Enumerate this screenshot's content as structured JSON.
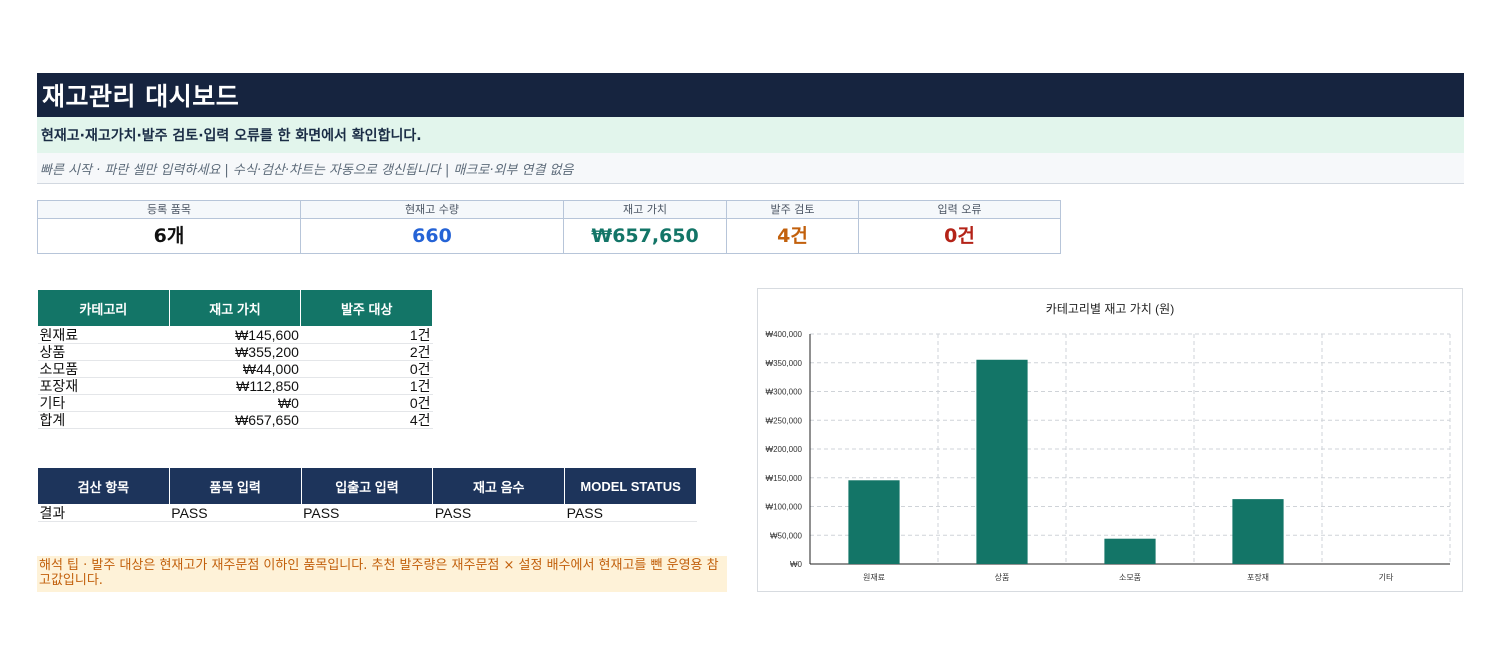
{
  "header": {
    "title": "재고관리 대시보드",
    "subtitle": "현재고·재고가치·발주 검토·입력 오류를 한 화면에서 확인합니다.",
    "quick_start": "빠른 시작 · 파란 셀만 입력하세요 | 수식·검산·차트는 자동으로 갱신됩니다 | 매크로·외부 연결 없음"
  },
  "kpis": [
    {
      "label": "등록 품목",
      "value": "6개",
      "color": "#111111"
    },
    {
      "label": "현재고 수량",
      "value": "660",
      "color": "#2563d6"
    },
    {
      "label": "재고 가치",
      "value": "₩657,650",
      "color": "#137567"
    },
    {
      "label": "발주 검토",
      "value": "4건",
      "color": "#c2600c"
    },
    {
      "label": "입력 오류",
      "value": "0건",
      "color": "#b42318"
    }
  ],
  "category_table": {
    "headers": [
      "카테고리",
      "재고 가치",
      "발주 대상"
    ],
    "rows": [
      [
        "원재료",
        "₩145,600",
        "1건"
      ],
      [
        "상품",
        "₩355,200",
        "2건"
      ],
      [
        "소모품",
        "₩44,000",
        "0건"
      ],
      [
        "포장재",
        "₩112,850",
        "1건"
      ],
      [
        "기타",
        "₩0",
        "0건"
      ],
      [
        "합계",
        "₩657,650",
        "4건"
      ]
    ]
  },
  "check_table": {
    "headers": [
      "검산 항목",
      "품목 입력",
      "입출고 입력",
      "재고 음수",
      "MODEL STATUS"
    ],
    "rows": [
      [
        "결과",
        "PASS",
        "PASS",
        "PASS",
        "PASS"
      ]
    ]
  },
  "tip": "해석 팁 · 발주 대상은 현재고가 재주문점 이하인 품목입니다. 추천 발주량은 재주문점 × 설정 배수에서 현재고를 뺀 운영용 참고값입니다.",
  "chart_data": {
    "type": "bar",
    "title": "카테고리별 재고 가치 (원)",
    "categories": [
      "원재료",
      "상품",
      "소모품",
      "포장재",
      "기타"
    ],
    "values": [
      145600,
      355200,
      44000,
      112850,
      0
    ],
    "ylim": [
      0,
      400000
    ],
    "yticks": [
      0,
      50000,
      100000,
      150000,
      200000,
      250000,
      300000,
      350000,
      400000
    ],
    "ytick_labels": [
      "₩0",
      "₩50,000",
      "₩100,000",
      "₩150,000",
      "₩200,000",
      "₩250,000",
      "₩300,000",
      "₩350,000",
      "₩400,000"
    ],
    "xlabel": "",
    "ylabel": "",
    "grid": true,
    "bar_color": "#137567"
  }
}
